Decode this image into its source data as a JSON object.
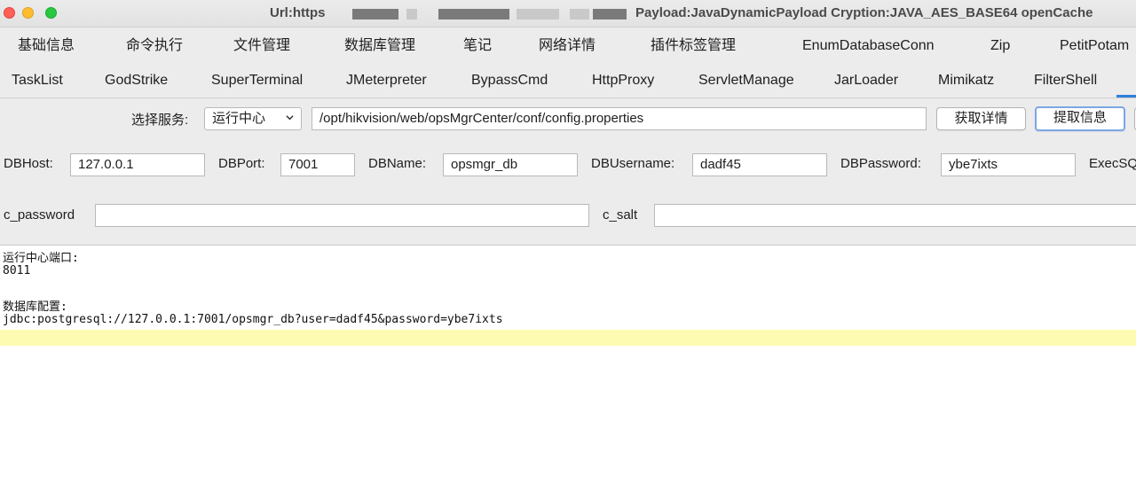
{
  "window": {
    "title_left": "Url:https",
    "title_right": "Payload:JavaDynamicPayload Cryption:JAVA_AES_BASE64 openCache"
  },
  "tabs_row1": [
    "基础信息",
    "命令执行",
    "文件管理",
    "数据库管理",
    "笔记",
    "网络详情",
    "插件标签管理",
    "EnumDatabaseConn",
    "Zip",
    "PetitPotam"
  ],
  "tabs_row2": [
    "TaskList",
    "GodStrike",
    "SuperTerminal",
    "JMeterpreter",
    "BypassCmd",
    "HttpProxy",
    "ServletManage",
    "JarLoader",
    "Mimikatz",
    "FilterShell"
  ],
  "service": {
    "label": "选择服务:",
    "selected": "运行中心",
    "path": "/opt/hikvision/web/opsMgrCenter/conf/config.properties",
    "get_details": "获取详情",
    "extract_info": "提取信息"
  },
  "db": {
    "host_label": "DBHost:",
    "host": "127.0.0.1",
    "port_label": "DBPort:",
    "port": "7001",
    "name_label": "DBName:",
    "name": "opsmgr_db",
    "user_label": "DBUsername:",
    "user": "dadf45",
    "pass_label": "DBPassword:",
    "pass": "ybe7ixts",
    "exec_label": "ExecSQ"
  },
  "creds": {
    "c_password_label": "c_password",
    "c_password": "",
    "c_salt_label": "c_salt",
    "c_salt": ""
  },
  "output": {
    "line1": "运行中心端口:",
    "line2": "8011",
    "line3": "",
    "line4": "数据库配置:",
    "line5": "jdbc:postgresql://127.0.0.1:7001/opsmgr_db?user=dadf45&password=ybe7ixts"
  },
  "colors": {
    "accent": "#2f7fdc",
    "highlight": "#fdfbb2"
  }
}
